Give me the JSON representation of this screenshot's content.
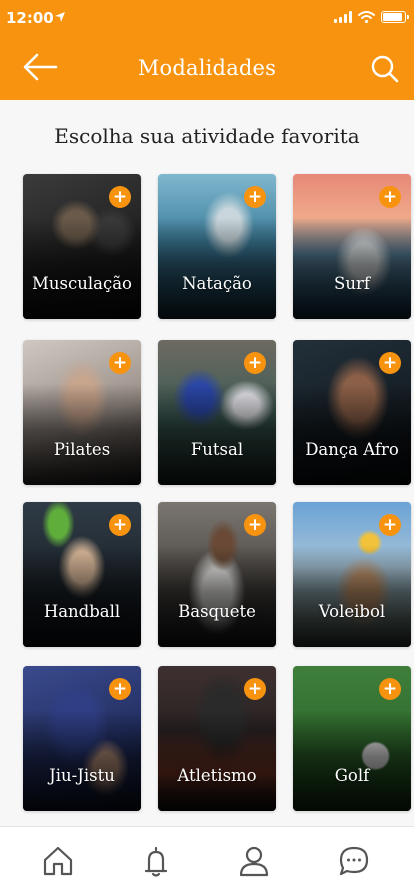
{
  "status_bar": {
    "time": "12:00"
  },
  "header": {
    "title": "Modalidades"
  },
  "subtitle": "Escolha sua atividade favorita",
  "add_symbol": "+",
  "activities": [
    {
      "label": "Musculação"
    },
    {
      "label": "Natação"
    },
    {
      "label": "Surf"
    },
    {
      "label": "Pilates"
    },
    {
      "label": "Futsal"
    },
    {
      "label": "Dança Afro"
    },
    {
      "label": "Handball"
    },
    {
      "label": "Basquete"
    },
    {
      "label": "Voleibol"
    },
    {
      "label": "Jiu-Jistu"
    },
    {
      "label": "Atletismo"
    },
    {
      "label": "Golf"
    }
  ],
  "icons": {
    "back": "arrow-left-icon",
    "search": "search-icon",
    "home": "home-icon",
    "notifications": "bell-icon",
    "profile": "user-icon",
    "chat": "chat-icon"
  },
  "colors": {
    "accent": "#f7930f",
    "tab_icon": "#555555"
  }
}
